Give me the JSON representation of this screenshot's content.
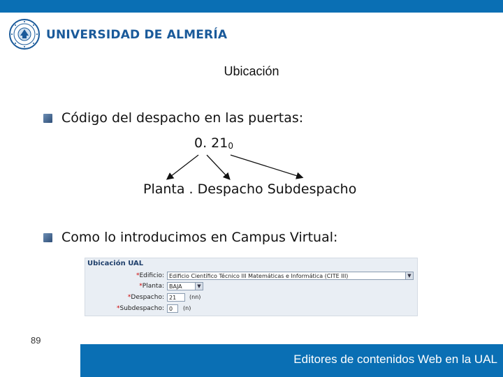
{
  "header": {
    "university_name": "UNIVERSIDAD DE ALMERÍA",
    "accent_color": "#0a6fb4"
  },
  "slide": {
    "title": "Ubicación",
    "bullet1": "Código del despacho en las puertas:",
    "code_main": "0. 21",
    "code_sub": "0",
    "parts_label": "Planta . Despacho Subdespacho",
    "bullet2": "Como lo introducimos en Campus Virtual:"
  },
  "form": {
    "title": "Ubicación UAL",
    "rows": [
      {
        "required": "*",
        "label": "Edificio:",
        "value": "Edificio Científico Técnico III Matemáticas e Informática (CITE III)",
        "kind": "select-wide"
      },
      {
        "required": "*",
        "label": "Planta:",
        "value": "BAJA",
        "kind": "select-narrow"
      },
      {
        "required": "*",
        "label": "Despacho:",
        "value": "21",
        "hint": "(nn)",
        "kind": "input"
      },
      {
        "required": "*",
        "label": "Subdespacho:",
        "value": "0",
        "hint": "(n)",
        "kind": "input"
      }
    ]
  },
  "footer": {
    "page_number": "89",
    "text": "Editores de contenidos Web en la UAL"
  }
}
